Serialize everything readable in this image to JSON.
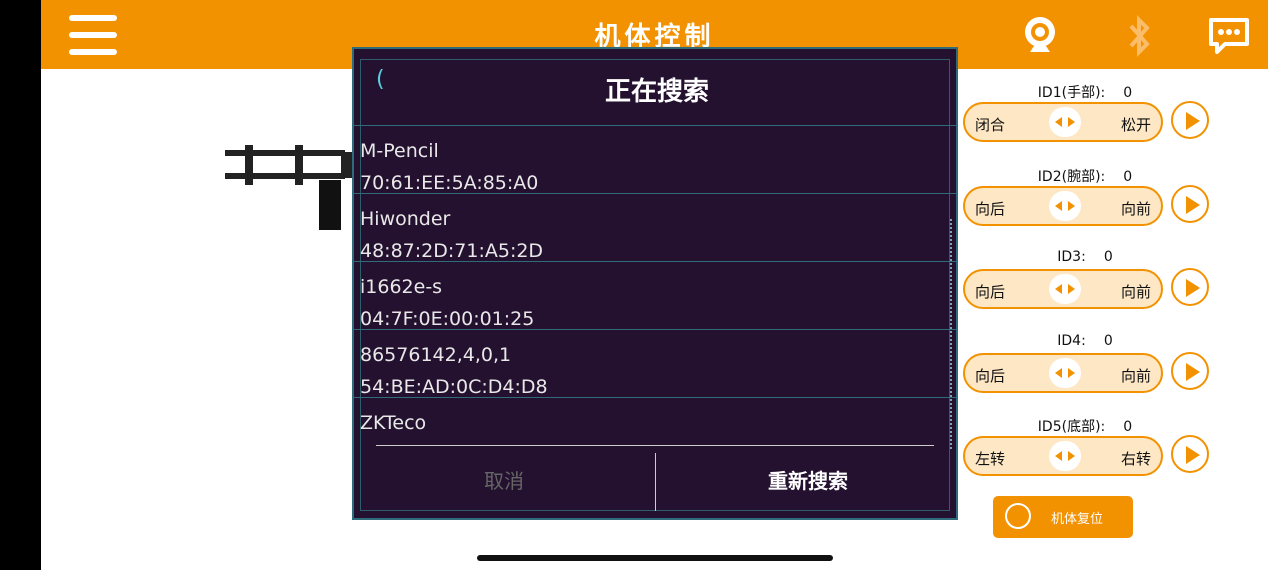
{
  "header": {
    "title": "机体控制"
  },
  "icons": {
    "menu": "menu-icon",
    "camera": "camera-icon",
    "bluetooth": "bluetooth-icon",
    "chat": "chat-icon"
  },
  "colors": {
    "accent": "#f39200",
    "dialog_bg": "#23112f",
    "dialog_border": "#2f6b7a"
  },
  "controls": [
    {
      "label": "ID1(手部):",
      "value": "0",
      "left": "闭合",
      "right": "松开"
    },
    {
      "label": "ID2(腕部):",
      "value": "0",
      "left": "向后",
      "right": "向前"
    },
    {
      "label": "ID3:",
      "value": "0",
      "left": "向后",
      "right": "向前"
    },
    {
      "label": "ID4:",
      "value": "0",
      "left": "向后",
      "right": "向前"
    },
    {
      "label": "ID5(底部):",
      "value": "0",
      "left": "左转",
      "right": "右转"
    }
  ],
  "reset_button": {
    "label": "机体复位"
  },
  "dialog": {
    "title": "正在搜索",
    "spinner": "(",
    "devices": [
      {
        "name": "M-Pencil",
        "mac": "70:61:EE:5A:85:A0"
      },
      {
        "name": "Hiwonder",
        "mac": "48:87:2D:71:A5:2D"
      },
      {
        "name": "i1662e-s",
        "mac": "04:7F:0E:00:01:25"
      },
      {
        "name": "86576142,4,0,1",
        "mac": "54:BE:AD:0C:D4:D8"
      },
      {
        "name": "ZKTeco",
        "mac": ""
      }
    ],
    "cancel": "取消",
    "research": "重新搜索"
  }
}
